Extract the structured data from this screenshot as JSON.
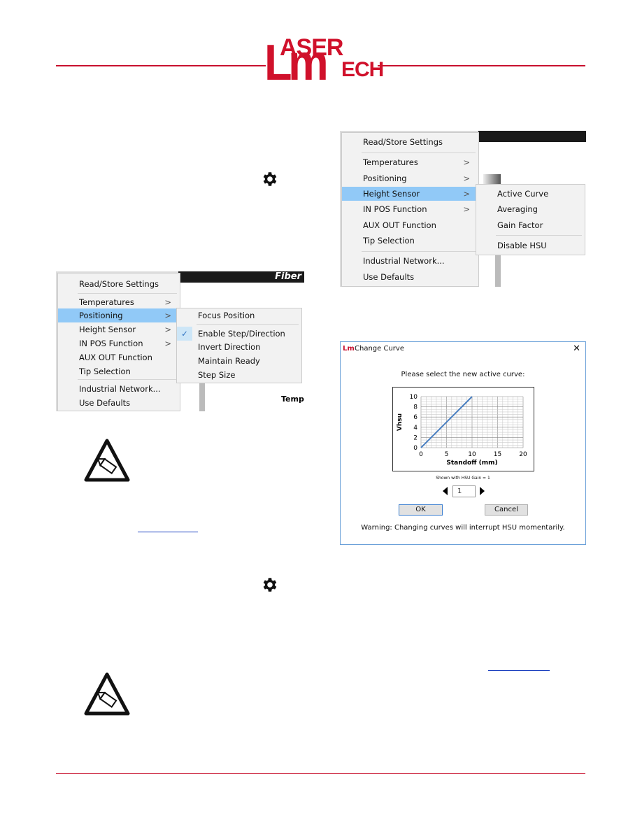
{
  "logo": {
    "text": "LASER MECH",
    "top": "ASER",
    "bottom": "ECH",
    "letters": "Lm"
  },
  "colors": {
    "brand": "#c8102e",
    "highlight": "#91c9f7",
    "curve": "#4a7fc1"
  },
  "icons": [
    "gear-icon",
    "warning-pencil-icon"
  ],
  "left_menu": {
    "items": [
      {
        "label": "Read/Store Settings"
      },
      {
        "label": "Temperatures",
        "arrow": ">"
      },
      {
        "label": "Positioning",
        "arrow": ">",
        "highlighted": true
      },
      {
        "label": "Height Sensor",
        "arrow": ">"
      },
      {
        "label": "IN POS Function",
        "arrow": ">"
      },
      {
        "label": "AUX OUT Function"
      },
      {
        "label": "Tip Selection"
      },
      {
        "label": "Industrial Network..."
      },
      {
        "label": "Use Defaults"
      }
    ],
    "submenu": [
      {
        "label": "Focus Position"
      },
      {
        "label": "Enable Step/Direction",
        "checked": true
      },
      {
        "label": "Invert Direction"
      },
      {
        "label": "Maintain Ready"
      },
      {
        "label": "Step Size"
      }
    ],
    "bg_header": "Fiber",
    "bg_label": "Temp"
  },
  "right_menu": {
    "items": [
      {
        "label": "Read/Store Settings"
      },
      {
        "label": "Temperatures",
        "arrow": ">"
      },
      {
        "label": "Positioning",
        "arrow": ">"
      },
      {
        "label": "Height Sensor",
        "arrow": ">",
        "highlighted": true
      },
      {
        "label": "IN POS Function",
        "arrow": ">"
      },
      {
        "label": "AUX OUT Function"
      },
      {
        "label": "Tip Selection"
      },
      {
        "label": "Industrial Network..."
      },
      {
        "label": "Use Defaults"
      }
    ],
    "submenu": [
      {
        "label": "Active Curve"
      },
      {
        "label": "Averaging"
      },
      {
        "label": "Gain Factor"
      },
      {
        "label": "Disable HSU"
      }
    ]
  },
  "dialog": {
    "icon_text": "Lm",
    "title": "Change Curve",
    "close": "✕",
    "prompt": "Please select the new active curve:",
    "caption": "Shown with HSU Gain = 1",
    "curve_value": "1",
    "ok": "OK",
    "cancel": "Cancel",
    "warning": "Warning: Changing curves will interrupt HSU momentarily."
  },
  "chart_data": {
    "type": "line",
    "xlabel": "Standoff (mm)",
    "ylabel": "Vhsu",
    "xlim": [
      0,
      20
    ],
    "ylim": [
      0,
      10
    ],
    "xticks": [
      0,
      5,
      10,
      15,
      20
    ],
    "yticks": [
      0,
      2,
      4,
      6,
      8,
      10
    ],
    "grid": true,
    "series": [
      {
        "x": [
          0,
          10
        ],
        "y": [
          0,
          10
        ]
      }
    ]
  }
}
